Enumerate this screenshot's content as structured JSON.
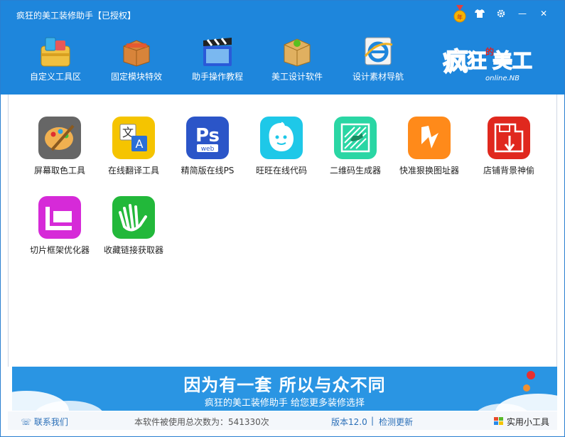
{
  "window": {
    "title": "疯狂的美工装修助手【已授权】",
    "controls": {
      "skin": "shirt-icon",
      "settings": "gear-icon",
      "minimize": "—",
      "close": "✕"
    }
  },
  "toolbar": {
    "items": [
      {
        "label": "自定义工具区",
        "icon": "toolbox-icon"
      },
      {
        "label": "固定模块特效",
        "icon": "box-icon"
      },
      {
        "label": "助手操作教程",
        "icon": "clapperboard-icon"
      },
      {
        "label": "美工设计软件",
        "icon": "package-icon"
      },
      {
        "label": "设计素材导航",
        "icon": "ie-browser-icon"
      }
    ],
    "logo_text_main": "疯狂的美工",
    "logo_text_sub": "online.NB"
  },
  "apps": [
    {
      "label": "屏幕取色工具",
      "icon": "palette-icon",
      "color": "#6b6b6b"
    },
    {
      "label": "在线翻译工具",
      "icon": "translate-icon",
      "color": "#f5c400"
    },
    {
      "label": "精简版在线PS",
      "icon": "photoshop-icon",
      "color": "#2b55c8",
      "ps": "Ps",
      "web": "web"
    },
    {
      "label": "旺旺在线代码",
      "icon": "wangwang-icon",
      "color": "#1ec8e8"
    },
    {
      "label": "二维码生成器",
      "icon": "qrcode-icon",
      "color": "#2ad6a4"
    },
    {
      "label": "快准狠换图址器",
      "icon": "lightning-icon",
      "color": "#ff8a1a"
    },
    {
      "label": "店铺背景神偷",
      "icon": "save-down-icon",
      "color": "#e0281e"
    },
    {
      "label": "切片框架优化器",
      "icon": "slice-frame-icon",
      "color": "#d62ad8"
    },
    {
      "label": "收藏链接获取器",
      "icon": "hand-wave-icon",
      "color": "#22b83a"
    }
  ],
  "banner": {
    "headline": "因为有一套 所以与众不同",
    "subline": "疯狂的美工装修助手 给您更多装修选择"
  },
  "status": {
    "contact": "联系我们",
    "usage_text": "本软件被使用总次数为：541330次",
    "version": "版本12.0",
    "separator": "|",
    "check_update": "检测更新",
    "tools": "实用小工具"
  }
}
